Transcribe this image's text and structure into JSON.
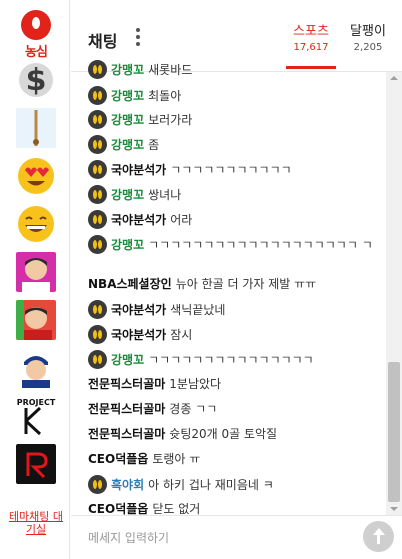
{
  "rail": {
    "logo_text": "농심",
    "emotes": [
      "dollar-emote",
      "stick-emote",
      "heart-eyes-emote",
      "grin-emote",
      "pink-face-emote",
      "red-face-emote",
      "player-emote",
      "project-k-emote",
      "red-r-emote"
    ],
    "theme_link": "테마채팅 대기실"
  },
  "header": {
    "title": "채팅",
    "tabs": [
      {
        "name": "스포츠",
        "count": "17,617",
        "active": true
      },
      {
        "name": "달팽이",
        "count": "2,205",
        "active": false
      }
    ]
  },
  "chat": {
    "messages": [
      {
        "badge": true,
        "nick": "강맹꼬",
        "color": "green",
        "text": "새롯바드"
      },
      {
        "badge": true,
        "nick": "강맹꼬",
        "color": "green",
        "text": "최돌아"
      },
      {
        "badge": true,
        "nick": "강맹꼬",
        "color": "green",
        "text": "보러가라"
      },
      {
        "badge": true,
        "nick": "강맹꼬",
        "color": "green",
        "text": "좀"
      },
      {
        "badge": true,
        "nick": "국야분석가",
        "color": "black",
        "text": "ㄱㄱㄱㄱㄱㄱㄱㄱㄱㄱㄱ"
      },
      {
        "badge": true,
        "nick": "강맹꼬",
        "color": "green",
        "text": "쌍녀나"
      },
      {
        "badge": true,
        "nick": "국야분석가",
        "color": "black",
        "text": "어라"
      },
      {
        "badge": true,
        "nick": "강맹꼬",
        "color": "green",
        "text": "ㄱㄱㄱㄱㄱㄱㄱㄱㄱㄱㄱㄱㄱㄱㄱㄱㄱㄱㄱ ㄱ"
      },
      {
        "badge": false,
        "nick": "NBA스페셜장인",
        "color": "black",
        "text": "뉴아 한골 더 가자 제발 ㅠㅠ"
      },
      {
        "badge": true,
        "nick": "국야분석가",
        "color": "black",
        "text": "색닉끝났네"
      },
      {
        "badge": true,
        "nick": "국야분석가",
        "color": "black",
        "text": "잠시"
      },
      {
        "badge": true,
        "nick": "강맹꼬",
        "color": "green",
        "text": "ㄱㄱㄱㄱㄱㄱㄱㄱㄱㄱㄱㄱㄱㄱㄱ"
      },
      {
        "badge": false,
        "nick": "전문픽스터골마",
        "color": "black",
        "text": "1분남았다"
      },
      {
        "badge": false,
        "nick": "전문픽스터골마",
        "color": "black",
        "text": "경종 ㄱㄱ"
      },
      {
        "badge": false,
        "nick": "전문픽스터골마",
        "color": "black",
        "text": "슛팅20개 0골 토악질"
      },
      {
        "badge": false,
        "nick": "CEO덕플옵",
        "color": "black",
        "text": "토랭아 ㅠ"
      },
      {
        "badge": true,
        "nick": "흑야회",
        "color": "blue",
        "text": "아 하키 겁나 재미음네 ㅋ"
      },
      {
        "badge": false,
        "nick": "CEO덕플옵",
        "color": "black",
        "text": "닫도 없거"
      }
    ]
  },
  "input": {
    "placeholder": "메세지 입력하기"
  },
  "colors": {
    "accent": "#e2231a",
    "green_nick": "#1a8a3a",
    "blue_nick": "#2b7fb0"
  }
}
